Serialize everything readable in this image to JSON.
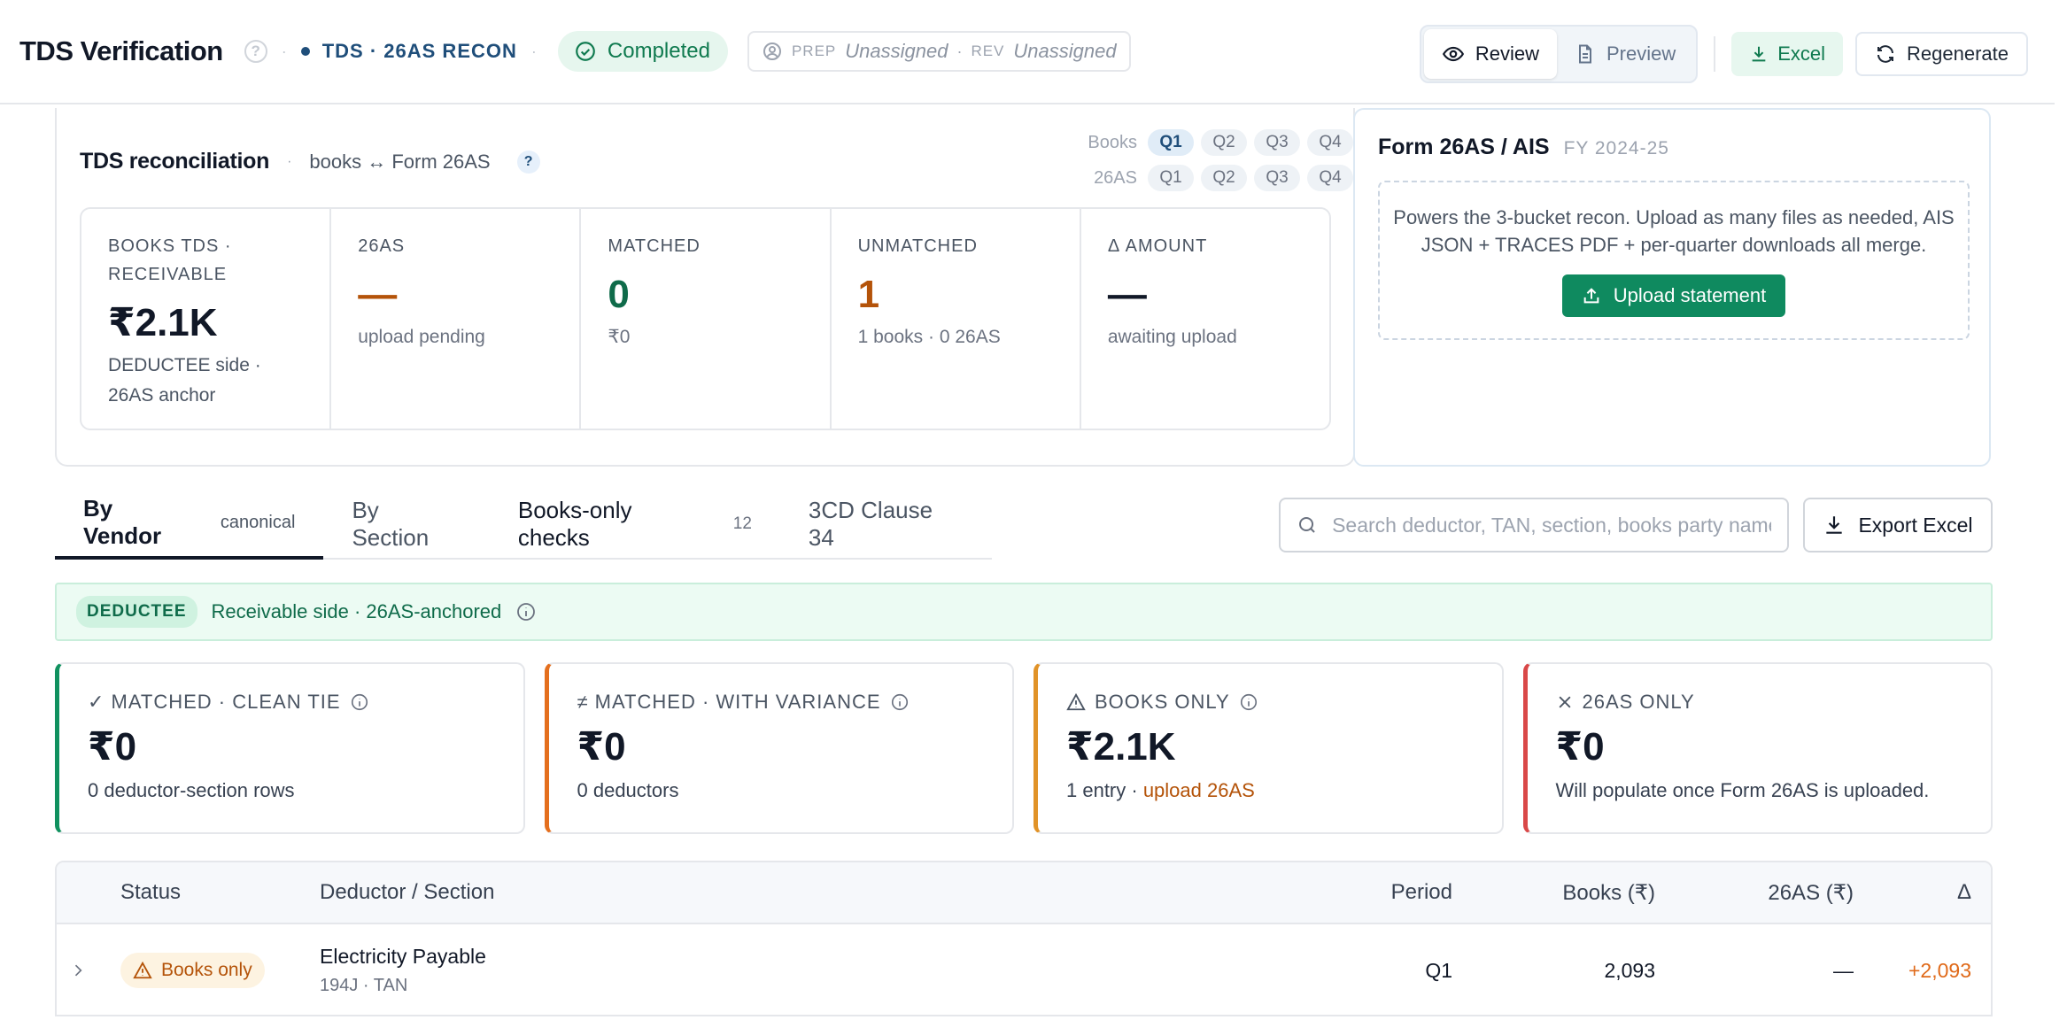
{
  "header": {
    "title": "TDS Verification",
    "help": "?",
    "module": "TDS · 26AS RECON",
    "status": "Completed",
    "prep_label": "PREP",
    "prep_value": "Unassigned",
    "rev_label": "REV",
    "rev_value": "Unassigned",
    "view_review": "Review",
    "view_preview": "Preview",
    "excel": "Excel",
    "regenerate": "Regenerate"
  },
  "recon": {
    "title": "TDS reconciliation",
    "subtitle": "books ↔ Form 26AS",
    "help": "?",
    "quarters": {
      "books_label": "Books",
      "as_label": "26AS",
      "books": [
        "Q1",
        "Q2",
        "Q3",
        "Q4"
      ],
      "as26": [
        "Q1",
        "Q2",
        "Q3",
        "Q4"
      ],
      "active": "Q1"
    },
    "metrics": [
      {
        "label": "BOOKS TDS · RECEIVABLE",
        "value": "₹2.1K",
        "note": "DEDUCTEE side · 26AS anchor"
      },
      {
        "label": "26AS",
        "value": "—",
        "note": "upload pending"
      },
      {
        "label": "MATCHED",
        "value": "0",
        "note": "₹0"
      },
      {
        "label": "UNMATCHED",
        "value": "1",
        "note": "1 books · 0 26AS"
      },
      {
        "label": "Δ AMOUNT",
        "value": "—",
        "note": "awaiting upload"
      }
    ]
  },
  "form26as": {
    "title": "Form 26AS / AIS",
    "fy": "FY 2024-25",
    "desc": "Powers the 3-bucket recon. Upload as many files as needed, AIS JSON + TRACES PDF + per-quarter downloads all merge.",
    "upload": "Upload statement"
  },
  "tabs": [
    {
      "label": "By Vendor",
      "extra": "canonical"
    },
    {
      "label": "By Section",
      "extra": ""
    },
    {
      "label": "Books-only checks",
      "extra": "12"
    },
    {
      "label": "3CD Clause 34",
      "extra": ""
    }
  ],
  "search": {
    "placeholder": "Search deductor, TAN, section, books party name"
  },
  "export": "Export Excel",
  "banner": {
    "badge": "DEDUCTEE",
    "text": "Receivable side · 26AS-anchored"
  },
  "buckets": [
    {
      "label": "✓ MATCHED · CLEAN TIE",
      "value": "₹0",
      "note": "0 deductor-section rows",
      "color": "#10915f"
    },
    {
      "label": "≠ MATCHED · WITH VARIANCE",
      "value": "₹0",
      "note": "0 deductors",
      "color": "#e46f1e"
    },
    {
      "label": "BOOKS ONLY",
      "value": "₹2.1K",
      "note": "1 entry · ",
      "link": "upload 26AS",
      "color": "#e19328"
    },
    {
      "label": "26AS ONLY",
      "value": "₹0",
      "note": "Will populate once Form 26AS is uploaded.",
      "color": "#d94848"
    }
  ],
  "table": {
    "columns": {
      "status": "Status",
      "deductor": "Deductor / Section",
      "period": "Period",
      "books": "Books (₹)",
      "as26": "26AS (₹)",
      "delta": "Δ"
    },
    "rows": [
      {
        "status": "Books only",
        "deductor": "Electricity Payable",
        "section": "194J · TAN",
        "period": "Q1",
        "books": "2,093",
        "as26": "—",
        "delta": "+2,093"
      }
    ]
  },
  "colors": {
    "accent_green": "#0f8a5f",
    "navy": "#1f4e7a",
    "warning": "#b45309"
  }
}
